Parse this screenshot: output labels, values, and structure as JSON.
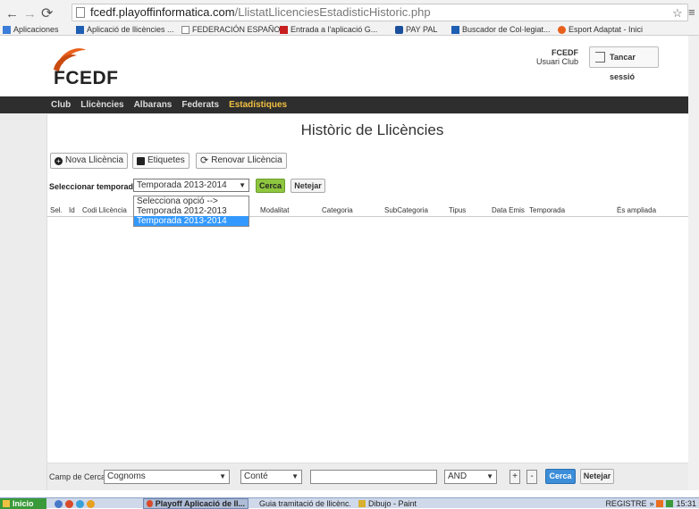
{
  "browser": {
    "url_host": "fcedf.playoffinformatica.com",
    "url_path": "/LlistatLlicenciesEstadisticHistoric.php",
    "bookmarks": [
      "Aplicaciones",
      "Aplicació de llicències ...",
      "FEDERACIÓN ESPAÑO...",
      "Entrada a l'aplicació G...",
      "PAY PAL",
      "Buscador de Col·legiat...",
      "Esport Adaptat - Inici"
    ]
  },
  "header": {
    "logo_text": "FCEDF",
    "user_name": "FCEDF",
    "user_role": "Usuari Club",
    "logout_label": "Tancar sessió"
  },
  "nav": {
    "items": [
      "Club",
      "Llicències",
      "Albarans",
      "Federats",
      "Estadístiques"
    ],
    "active": "Estadístiques"
  },
  "main": {
    "title": "Històric de Llicències",
    "actions": {
      "new_label": "Nova Llicència",
      "labels_label": "Etiquetes",
      "renew_label": "Renovar Llicència"
    },
    "season_label": "Seleccionar temporada >",
    "season_selected": "Temporada 2013-2014",
    "season_options": [
      "Selecciona opció -->",
      "Temporada 2012-2013",
      "Temporada 2013-2014"
    ],
    "search_label": "Cerca",
    "clear_label": "Netejar",
    "columns": [
      "Sel.",
      "Id",
      "Codi Llicència",
      "Modalitat",
      "Categoria",
      "SubCategoria",
      "Tipus",
      "Data Emis",
      "Temporada",
      "És ampliada"
    ]
  },
  "footer": {
    "field_label": "Camp de Cerca",
    "field_value": "Cognoms",
    "operator_value": "Conté",
    "search_value": "",
    "logic_value": "AND",
    "plus_label": "+",
    "minus_label": "-",
    "search_label": "Cerca",
    "clear_label": "Netejar"
  },
  "taskbar": {
    "start_label": "Inicio",
    "items": [
      "Playoff Aplicació de ll...",
      "Guia tramitació de llicènc...",
      "Dibujo - Paint"
    ],
    "right_label": "REGISTRE",
    "time": "15:31"
  },
  "colors": {
    "accent_nav": "#f0c040",
    "cerca_green": "#8ec63f",
    "dropdown_highlight": "#3399ff"
  }
}
